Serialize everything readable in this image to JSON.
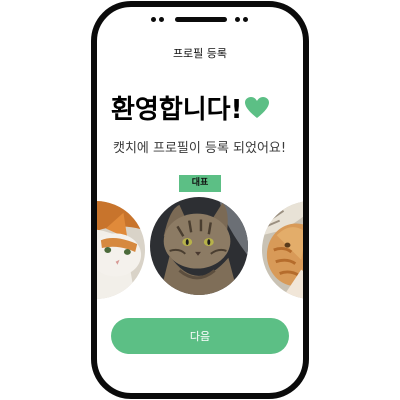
{
  "header": {
    "title": "프로필 등록"
  },
  "welcome": {
    "text": "환영합니다!"
  },
  "subtitle": "캣치에 프로필이 등록 되었어요!",
  "badge": {
    "label": "대표"
  },
  "carousel": {
    "items": [
      {
        "icon": "cat-photo-calico"
      },
      {
        "icon": "cat-photo-tabby"
      },
      {
        "icon": "cat-photo-orange"
      }
    ]
  },
  "next_button": {
    "label": "다음"
  },
  "colors": {
    "accent": "#5cbf85",
    "frame": "#0b0b0b"
  },
  "icons": {
    "heart": "heart-icon"
  }
}
